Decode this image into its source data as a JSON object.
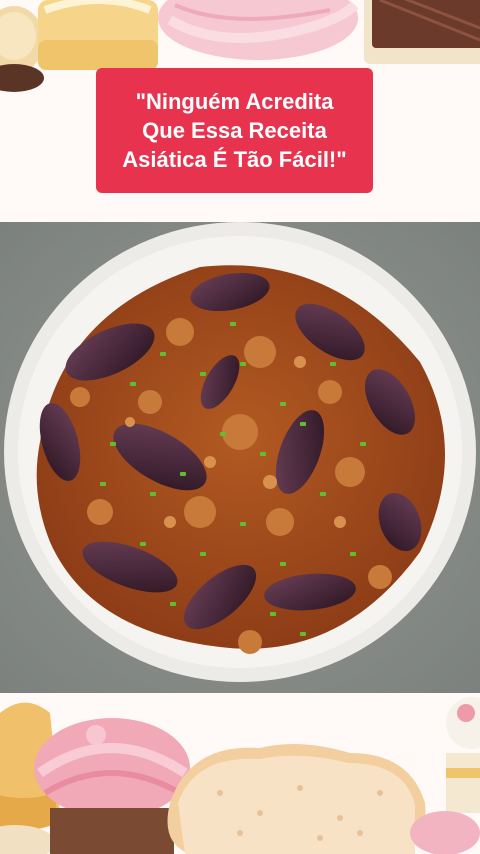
{
  "caption": {
    "text": "\"Ninguém Acredita\nQue Essa Receita\nAsiática É Tão Fácil!\""
  },
  "colors": {
    "caption_bg": "#e8334f",
    "caption_text": "#ffffff",
    "plate": "#f3f1ee",
    "tablecloth": "#8a8f8b",
    "eggplant": "#3e1f33",
    "sauce": "#a24a1c",
    "scallion": "#5fbf2e"
  },
  "icons": [
    "cupcake-illustration",
    "macaron-illustration",
    "donut-illustration",
    "cookie-illustration",
    "cake-slice-illustration"
  ]
}
